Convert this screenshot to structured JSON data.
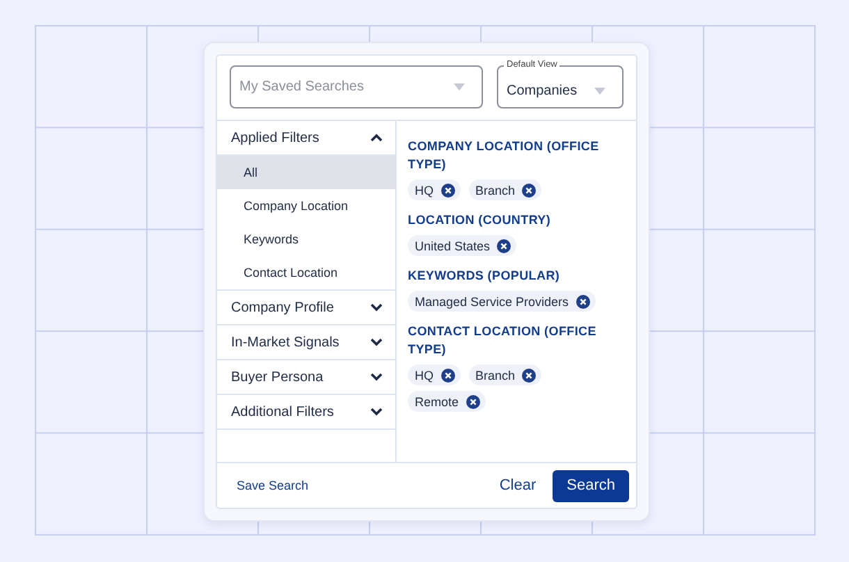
{
  "saved_searches": {
    "placeholder": "My Saved Searches"
  },
  "default_view": {
    "label": "Default View",
    "value": "Companies"
  },
  "sidebar": {
    "sections": [
      {
        "label": "Applied Filters",
        "expanded": true,
        "children": [
          {
            "label": "All",
            "selected": true
          },
          {
            "label": "Company Location",
            "selected": false
          },
          {
            "label": "Keywords",
            "selected": false
          },
          {
            "label": "Contact Location",
            "selected": false
          }
        ]
      },
      {
        "label": "Company Profile",
        "expanded": false
      },
      {
        "label": "In-Market Signals",
        "expanded": false
      },
      {
        "label": "Buyer Persona",
        "expanded": false
      },
      {
        "label": "Additional Filters",
        "expanded": false
      }
    ]
  },
  "filter_groups": [
    {
      "title": "COMPANY LOCATION (OFFICE TYPE)",
      "chips": [
        "HQ",
        "Branch"
      ]
    },
    {
      "title": "LOCATION (COUNTRY)",
      "chips": [
        "United States"
      ]
    },
    {
      "title": "KEYWORDS (POPULAR)",
      "chips": [
        "Managed Service Providers"
      ]
    },
    {
      "title": "CONTACT LOCATION (OFFICE TYPE)",
      "chips": [
        "HQ",
        "Branch",
        "Remote"
      ]
    }
  ],
  "footer": {
    "save_link": "Save Search",
    "clear_link": "Clear",
    "search_button": "Search"
  }
}
